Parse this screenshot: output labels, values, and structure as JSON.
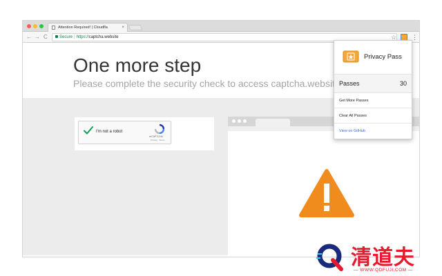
{
  "browser": {
    "tab_title": "Attention Required! | Cloudfla",
    "tab_close": "×",
    "nav": {
      "back": "←",
      "forward": "→",
      "reload": "C"
    },
    "address": {
      "secure_label": "Secure",
      "separator": "|",
      "scheme": "https://",
      "host": "captcha.website"
    },
    "star": "☆",
    "menu": "⋮"
  },
  "page": {
    "heading": "One more step",
    "subheading": "Please complete the security check to access captcha.website",
    "recaptcha": {
      "label": "I'm not a robot",
      "brand": "reCAPTCHA",
      "links": "Privacy - Terms"
    }
  },
  "popup": {
    "title": "Privacy Pass",
    "passes_label": "Passes",
    "passes_count": "30",
    "items": [
      {
        "label": "Get More Passes"
      },
      {
        "label": "Clear All Passes"
      },
      {
        "label": "View on GitHub"
      }
    ]
  },
  "watermark": {
    "text": "清道夫",
    "url": "— WWW.QDFUJI.COM —"
  },
  "colors": {
    "secure_green": "#0b8043",
    "warning_orange": "#f08c1e",
    "privacy_pass_gold": "#f3a83a",
    "link_blue": "#3b6fd6",
    "watermark_red": "#e8192c"
  },
  "icons": [
    "document-icon",
    "lock-icon",
    "star-icon",
    "privacy-pass-extension-icon",
    "checkmark-icon",
    "recaptcha-logo-icon",
    "warning-icon",
    "ticket-icon",
    "q-logo-icon"
  ]
}
